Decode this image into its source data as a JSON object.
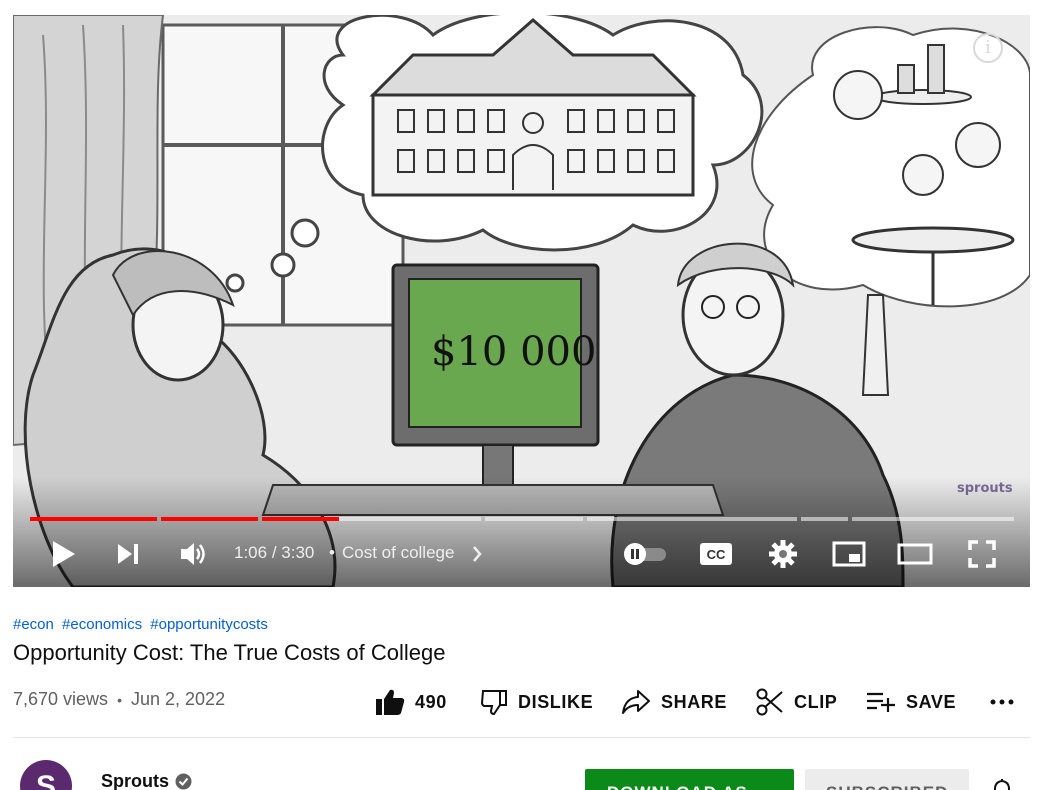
{
  "player": {
    "info_icon_glyph": "i",
    "watermark": "sprouts",
    "price_text": "$10 000",
    "progress_fraction": 0.314,
    "current_time": "1:06",
    "time_separator": "/",
    "duration": "3:30",
    "chapter_separator": "•",
    "chapter_title": "Cost of college",
    "cc_label": "CC",
    "icons": [
      "play-icon",
      "next-icon",
      "volume-icon",
      "chevron-right-icon",
      "autoplay-toggle-icon",
      "captions-icon",
      "settings-icon",
      "miniplayer-icon",
      "theater-mode-icon",
      "fullscreen-icon",
      "info-icon"
    ]
  },
  "video": {
    "hashtags": [
      "#econ",
      "#economics",
      "#opportunitycosts"
    ],
    "title": "Opportunity Cost: The True Costs of College",
    "views": "7,670 views",
    "meta_separator": "•",
    "date": "Jun 2, 2022"
  },
  "actions": {
    "like_count": "490",
    "dislike_label": "DISLIKE",
    "share_label": "SHARE",
    "clip_label": "CLIP",
    "save_label": "SAVE"
  },
  "channel": {
    "name": "Sprouts",
    "avatar_letter": "S",
    "download_label": "DOWNLOAD AS",
    "subscribed_label": "SUBSCRIBED"
  },
  "colors": {
    "progress_red": "#ff0000",
    "link_blue": "#065fd4",
    "download_green": "#0b8a1a",
    "monitor_green": "#6aa84f"
  }
}
